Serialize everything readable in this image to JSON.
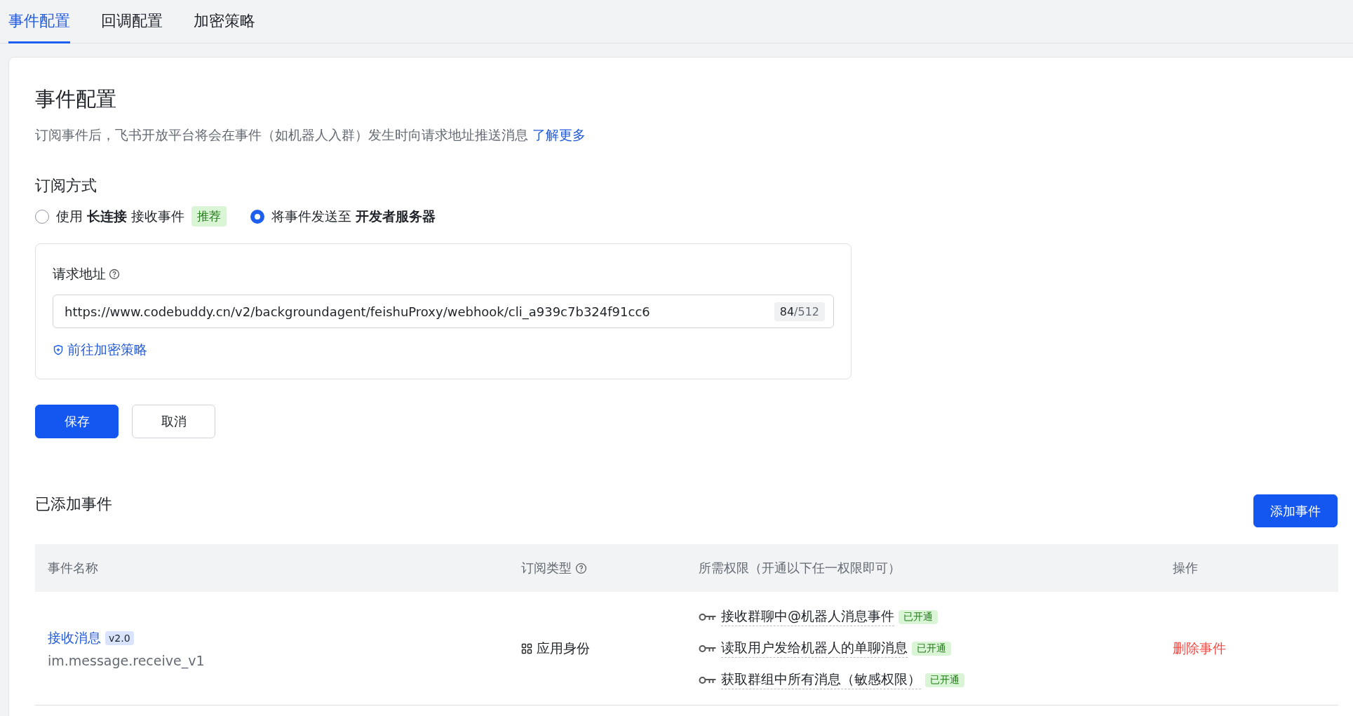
{
  "tabs": [
    {
      "label": "事件配置",
      "selected": true
    },
    {
      "label": "回调配置",
      "selected": false
    },
    {
      "label": "加密策略",
      "selected": false
    }
  ],
  "section": {
    "title": "事件配置",
    "description": "订阅事件后，飞书开放平台将会在事件（如机器人入群）发生时向请求地址推送消息",
    "link": "了解更多"
  },
  "subscription": {
    "title": "订阅方式",
    "options": [
      {
        "label": "使用 **长连接** 接收事件",
        "badge": "推荐",
        "selected": false
      },
      {
        "label": "将事件发送至 **开发者服务器**",
        "selected": true
      }
    ]
  },
  "request_url": {
    "label": "请求地址",
    "value": "https://www.codebuddy.cn/v2/backgroundagent/feishuProxy/webhook/cli_a939c7b324f91cc6",
    "count": "84",
    "max": "/512",
    "link": "前往加密策略"
  },
  "buttons": [
    {
      "label": "保存",
      "kind": "primary"
    },
    {
      "label": "取消",
      "kind": "secondary"
    }
  ],
  "events": {
    "title": "已添加事件",
    "add_button": "添加事件",
    "columns": [
      {
        "label": "事件名称",
        "help": false
      },
      {
        "label": "订阅类型",
        "help": true
      },
      {
        "label": "所需权限（开通以下任一权限即可）",
        "help": false
      },
      {
        "label": "操作",
        "help": false
      }
    ],
    "rows": [
      {
        "name": "接收消息",
        "version": "v2.0",
        "code": "im.message.receive_v1",
        "type": "应用身份",
        "permissions": [
          {
            "label": "接收群聊中@机器人消息事件",
            "status": "已开通"
          },
          {
            "label": "读取用户发给机器人的单聊消息",
            "status": "已开通"
          },
          {
            "label": "获取群组中所有消息（敏感权限）",
            "status": "已开通"
          }
        ],
        "action": "删除事件"
      }
    ]
  }
}
